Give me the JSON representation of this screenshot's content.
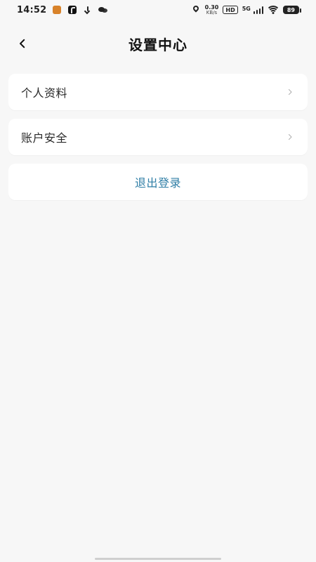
{
  "status_bar": {
    "time": "14:52",
    "net_speed_value": "0.30",
    "net_speed_unit": "KB/s",
    "hd_label": "HD",
    "signal_label": "5G",
    "battery_level": "89",
    "icons": [
      "app-notification-icon",
      "tiktok-icon",
      "download-icon",
      "wechat-icon",
      "location-icon",
      "hd-icon",
      "signal-icon",
      "wifi-icon",
      "battery-icon"
    ]
  },
  "header": {
    "title": "设置中心",
    "back_icon": "chevron-left-icon"
  },
  "menu": {
    "items": [
      {
        "label": "个人资料",
        "icon": "chevron-right-icon"
      },
      {
        "label": "账户安全",
        "icon": "chevron-right-icon"
      }
    ],
    "logout_label": "退出登录"
  },
  "colors": {
    "background": "#f7f7f7",
    "card": "#ffffff",
    "title": "#111111",
    "item_text": "#2a2a2a",
    "logout_text": "#2f7ea6",
    "chevron": "#b5b5b5"
  }
}
